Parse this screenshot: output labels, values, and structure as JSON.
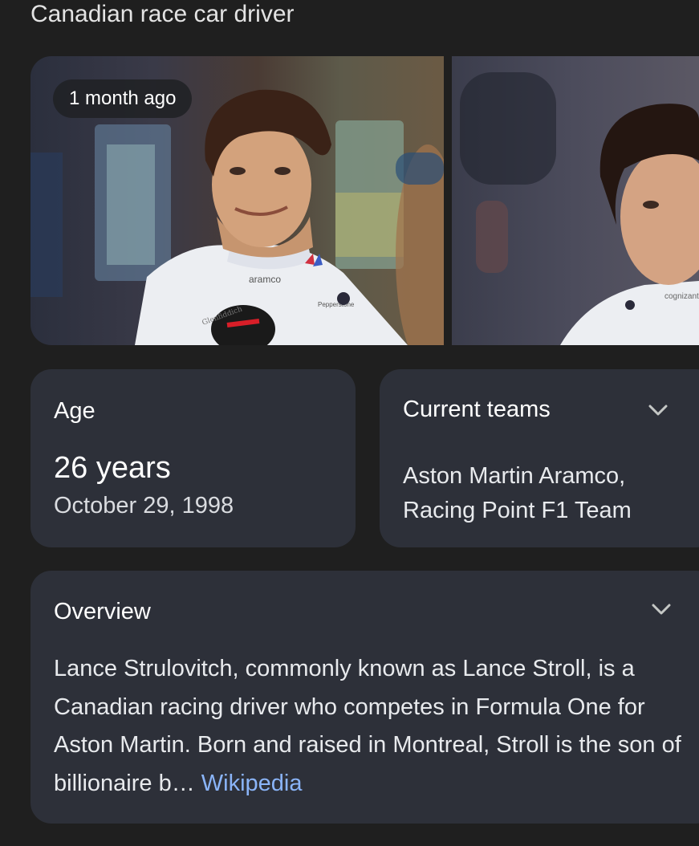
{
  "header": {
    "subtitle": "Canadian race car driver"
  },
  "images": {
    "badge": "1 month ago",
    "photo1_text": {
      "sponsor1": "aramco",
      "sponsor2": "Pepperstone",
      "sponsor3": "Glenfiddich"
    },
    "photo2_text": {
      "sponsor1": "cognizant"
    }
  },
  "age_card": {
    "heading": "Age",
    "value": "26 years",
    "birth_date": "October 29, 1998"
  },
  "teams_card": {
    "heading": "Current teams",
    "value": "Aston Martin Aramco, Racing Point F1 Team",
    "expand_icon": "chevron-down-icon"
  },
  "overview_card": {
    "heading": "Overview",
    "text": "Lance Strulovitch, commonly known as Lance Stroll, is a Canadian racing driver who competes in Formula One for Aston Martin. Born and raised in Montreal, Stroll is the son of billionaire b… ",
    "source_link": "Wikipedia",
    "expand_icon": "chevron-down-icon"
  },
  "colors": {
    "background": "#1f1f1f",
    "card": "#2d3039",
    "link": "#8ab4f8"
  }
}
